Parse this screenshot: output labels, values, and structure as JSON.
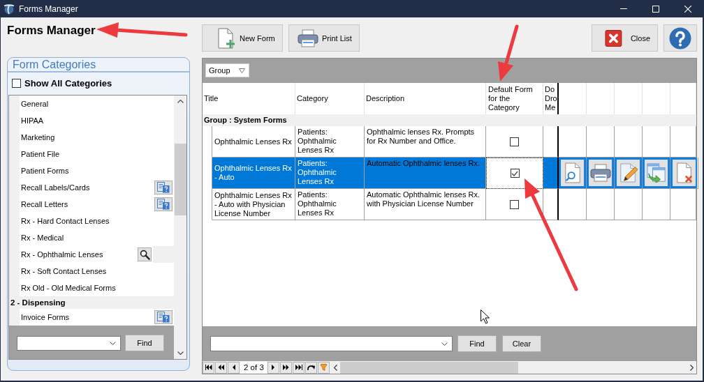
{
  "window": {
    "title": "Forms Manager"
  },
  "heading": "Forms Manager",
  "categories": {
    "title": "Form Categories",
    "show_all": {
      "label": "Show All Categories",
      "checked": false
    },
    "items": [
      {
        "kind": "item",
        "label": "General"
      },
      {
        "kind": "item",
        "label": "HIPAA"
      },
      {
        "kind": "item",
        "label": "Marketing"
      },
      {
        "kind": "item",
        "label": "Patient File"
      },
      {
        "kind": "item",
        "label": "Patient Forms"
      },
      {
        "kind": "item",
        "label": "Recall Labels/Cards",
        "button": {
          "kind": "info"
        }
      },
      {
        "kind": "item",
        "label": "Recall Letters",
        "button": {
          "kind": "info"
        }
      },
      {
        "kind": "item",
        "label": "Rx - Hard Contact Lenses"
      },
      {
        "kind": "item",
        "label": "Rx - Medical"
      },
      {
        "kind": "item",
        "label": "Rx - Ophthalmic Lenses",
        "button": {
          "kind": "search"
        }
      },
      {
        "kind": "item",
        "label": "Rx - Soft Contact Lenses"
      },
      {
        "kind": "item",
        "label": "Rx Old - Old Medical Forms"
      },
      {
        "kind": "group",
        "label": "2 - Dispensing"
      },
      {
        "kind": "item",
        "label": "Invoice Forms",
        "button": {
          "kind": "info"
        }
      }
    ],
    "find_button": "Find"
  },
  "toolbar": [
    {
      "kind": "new",
      "label": "New Form"
    },
    {
      "kind": "print",
      "label": "Print List"
    }
  ],
  "close_button": "Close",
  "grid": {
    "group_by": "Group",
    "columns": [
      "Title",
      "Category",
      "Description",
      "Default Form for the Category",
      "Do Dro Me"
    ],
    "group": "Group : System Forms",
    "rows": [
      {
        "title": "Ophthalmic Lenses Rx",
        "category": "Patients: Ophthalmic Lenses Rx",
        "description": "Ophthalmic lenses Rx. Prompts for Rx Number and Office.",
        "default_form": false,
        "selected": false
      },
      {
        "title": "Ophthalmic Lenses Rx - Auto",
        "category": "Patients: Ophthalmic Lenses Rx",
        "description": "Automatic Ophthalmic lenses Rx.",
        "default_form": true,
        "selected": true
      },
      {
        "title": "Ophthalmic Lenses Rx - Auto with Physician License Number",
        "category": "Patients: Ophthalmic Lenses Rx",
        "description": "Automatic Ophthalmic lenses Rx. with Physician License Number",
        "default_form": false,
        "selected": false
      }
    ],
    "find_button": "Find",
    "clear_button": "Clear",
    "page": "2 of 3"
  }
}
